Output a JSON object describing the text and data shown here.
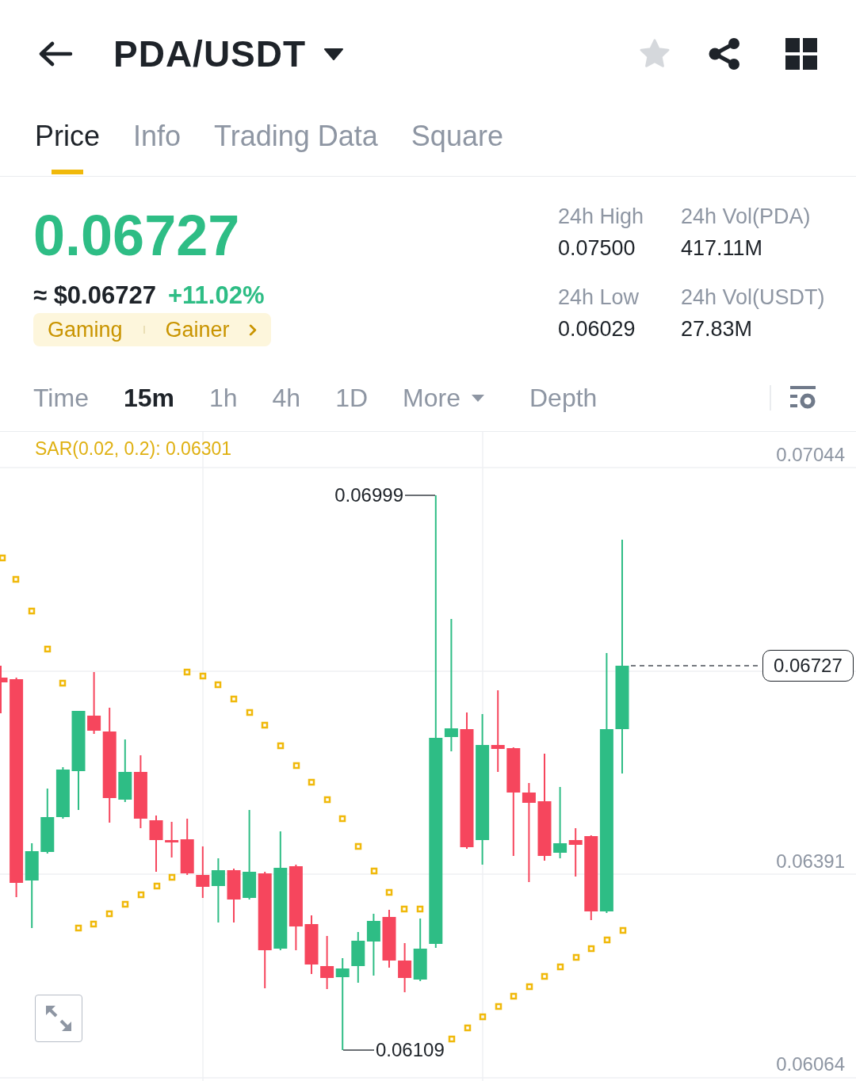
{
  "header": {
    "pair": "PDA/USDT",
    "favorited": false
  },
  "tabs": [
    {
      "label": "Price",
      "selected": true
    },
    {
      "label": "Info",
      "selected": false
    },
    {
      "label": "Trading Data",
      "selected": false
    },
    {
      "label": "Square",
      "selected": false
    }
  ],
  "ticker": {
    "last_price": "0.06727",
    "fiat_price": "≈ $0.06727",
    "change": "+11.02%",
    "rising": true,
    "tags": [
      "Gaming",
      "Gainer"
    ]
  },
  "stats": [
    {
      "label": "24h High",
      "value": "0.07500"
    },
    {
      "label": "24h Vol(PDA)",
      "value": "417.11M"
    },
    {
      "label": "24h Low",
      "value": "0.06029"
    },
    {
      "label": "24h Vol(USDT)",
      "value": "27.83M"
    }
  ],
  "chart_tabs": [
    {
      "label": "Time",
      "selected": false,
      "kind": "option"
    },
    {
      "label": "15m",
      "selected": true,
      "kind": "option"
    },
    {
      "label": "1h",
      "selected": false,
      "kind": "option"
    },
    {
      "label": "4h",
      "selected": false,
      "kind": "option"
    },
    {
      "label": "1D",
      "selected": false,
      "kind": "option"
    },
    {
      "label": "More",
      "selected": false,
      "kind": "dropdown"
    },
    {
      "label": "Depth",
      "selected": false,
      "kind": "option"
    }
  ],
  "chart": {
    "indicator": "SAR(0.02, 0.2): 0.06301",
    "price_axis": [
      "0.07044",
      "0.06391",
      "0.06064"
    ],
    "high_label": "0.06999",
    "low_label": "0.06109",
    "current_price": "0.06727"
  }
}
